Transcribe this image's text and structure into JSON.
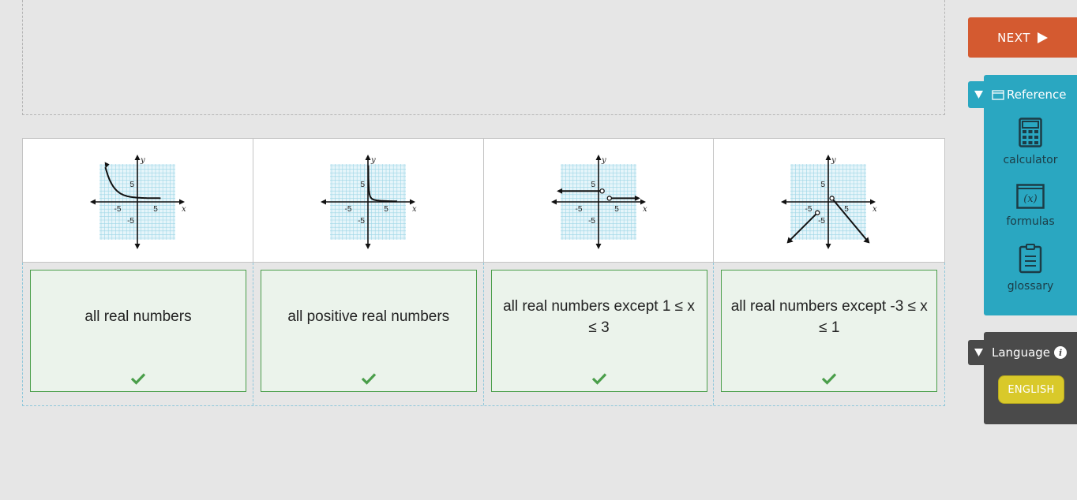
{
  "navigation": {
    "next_label": "NEXT",
    "next_icon": "play-triangle-icon"
  },
  "matching": {
    "graphs": [
      {
        "description_icon": "graph-exponential-decay"
      },
      {
        "description_icon": "graph-reciprocal-positive"
      },
      {
        "description_icon": "graph-piecewise-horizontal-rays"
      },
      {
        "description_icon": "graph-absolute-value-rays"
      }
    ],
    "graph_axis_labels": {
      "x": "x",
      "y": "y",
      "pos5": "5",
      "neg5": "-5"
    },
    "answers": [
      {
        "text": "all real numbers",
        "status": "correct"
      },
      {
        "text": "all positive real numbers",
        "status": "correct"
      },
      {
        "text": "all real numbers except 1 ≤ x ≤ 3",
        "status": "correct"
      },
      {
        "text": "all real numbers except -3 ≤ x ≤ 1",
        "status": "correct"
      }
    ],
    "correct_color": "#4a9e4a"
  },
  "reference": {
    "title": "Reference",
    "toggle_icon": "triangle-down-icon",
    "tools": [
      {
        "label": "calculator",
        "icon": "calculator-icon"
      },
      {
        "label": "formulas",
        "icon": "formulas-icon"
      },
      {
        "label": "glossary",
        "icon": "glossary-icon"
      }
    ],
    "formula_glyph": "(x)",
    "color": "#2aa7c1"
  },
  "language": {
    "title": "Language",
    "toggle_icon": "triangle-down-icon",
    "button_label": "ENGLISH",
    "info_glyph": "i"
  },
  "colors": {
    "next": "#d45a30",
    "language_button": "#d9c92a",
    "panel_dark": "#4a4a4a"
  }
}
